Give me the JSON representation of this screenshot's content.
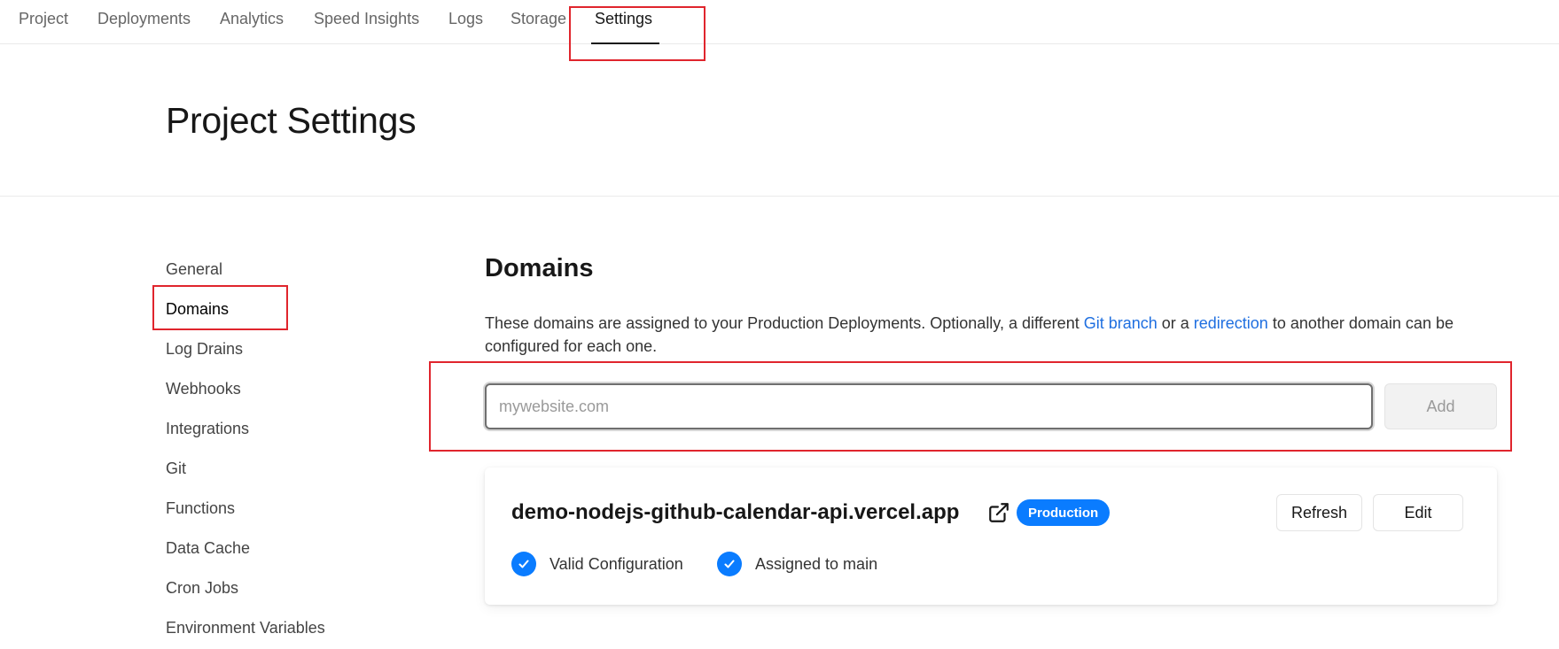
{
  "topnav": {
    "tabs": [
      {
        "label": "Project"
      },
      {
        "label": "Deployments"
      },
      {
        "label": "Analytics"
      },
      {
        "label": "Speed Insights"
      },
      {
        "label": "Logs"
      },
      {
        "label": "Storage"
      },
      {
        "label": "Settings",
        "active": true
      }
    ]
  },
  "page": {
    "title": "Project Settings"
  },
  "sidebar": {
    "items": [
      {
        "label": "General"
      },
      {
        "label": "Domains",
        "active": true
      },
      {
        "label": "Log Drains"
      },
      {
        "label": "Webhooks"
      },
      {
        "label": "Integrations"
      },
      {
        "label": "Git"
      },
      {
        "label": "Functions"
      },
      {
        "label": "Data Cache"
      },
      {
        "label": "Cron Jobs"
      },
      {
        "label": "Environment Variables"
      }
    ]
  },
  "domains": {
    "title": "Domains",
    "description": {
      "part1": "These domains are assigned to your Production Deployments. Optionally, a different ",
      "link1": "Git branch",
      "part2": " or a ",
      "link2": "redirection",
      "part3": " to another domain can be configured for each one."
    },
    "input": {
      "placeholder": "mywebsite.com",
      "value": ""
    },
    "add_label": "Add",
    "card": {
      "domain": "demo-nodejs-github-calendar-api.vercel.app",
      "badge": "Production",
      "refresh_label": "Refresh",
      "edit_label": "Edit",
      "statuses": [
        {
          "label": "Valid Configuration",
          "icon": "check-circle-icon"
        },
        {
          "label": "Assigned to main",
          "icon": "check-circle-icon"
        }
      ]
    }
  },
  "colors": {
    "accent": "#0a7cff",
    "link": "#1f6fe0",
    "highlight": "#e0252d"
  }
}
